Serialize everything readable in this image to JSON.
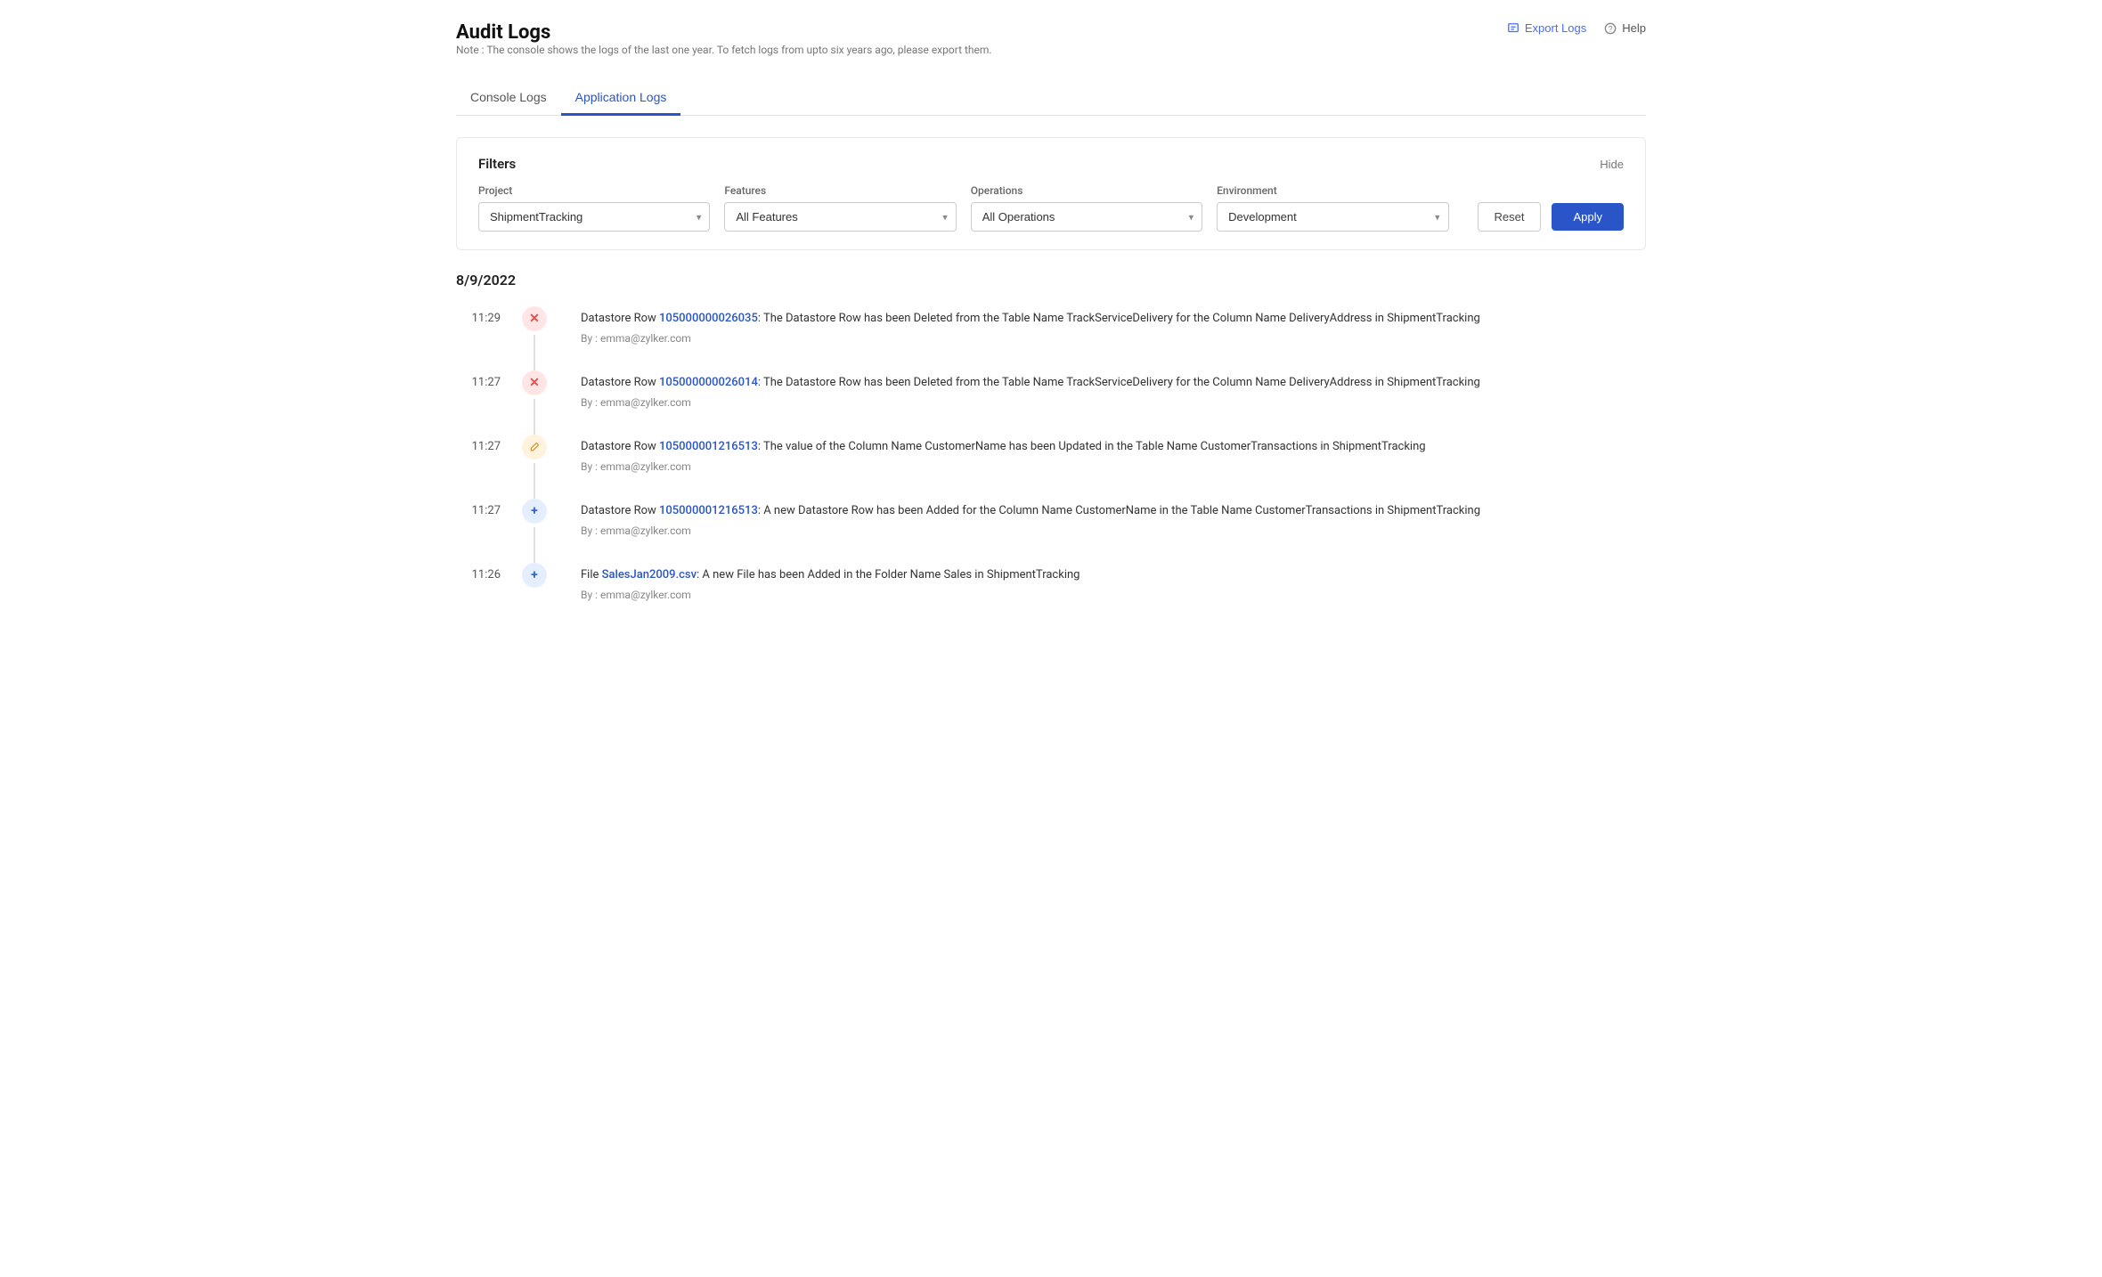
{
  "page": {
    "title": "Audit Logs",
    "note": "Note : The console shows the logs of the last one year. To fetch logs from upto six years ago, please export them."
  },
  "header": {
    "export_label": "Export Logs",
    "help_label": "Help"
  },
  "tabs": [
    {
      "id": "console",
      "label": "Console Logs",
      "active": false
    },
    {
      "id": "application",
      "label": "Application Logs",
      "active": true
    }
  ],
  "filters": {
    "title": "Filters",
    "hide_label": "Hide",
    "reset_label": "Reset",
    "apply_label": "Apply",
    "project": {
      "label": "Project",
      "value": "ShipmentTracking"
    },
    "features": {
      "label": "Features",
      "value": "All Features"
    },
    "operations": {
      "label": "Operations",
      "value": "All Operations"
    },
    "environment": {
      "label": "Environment",
      "value": "Development"
    }
  },
  "date_group": {
    "date": "8/9/2022"
  },
  "logs": [
    {
      "time": "11:29",
      "icon_type": "delete",
      "icon_symbol": "✕",
      "message_prefix": "Datastore Row",
      "link_text": "105000000026035",
      "message_suffix": ": The Datastore Row has been Deleted from the Table Name TrackServiceDelivery for the Column Name DeliveryAddress in ShipmentTracking",
      "by": "By : emma@zylker.com"
    },
    {
      "time": "11:27",
      "icon_type": "delete",
      "icon_symbol": "✕",
      "message_prefix": "Datastore Row",
      "link_text": "105000000026014",
      "message_suffix": ": The Datastore Row has been Deleted from the Table Name TrackServiceDelivery for the Column Name DeliveryAddress in ShipmentTracking",
      "by": "By : emma@zylker.com"
    },
    {
      "time": "11:27",
      "icon_type": "edit",
      "icon_symbol": "✎",
      "message_prefix": "Datastore Row",
      "link_text": "105000001216513",
      "message_suffix": ": The value of the Column Name CustomerName has been Updated in the Table Name CustomerTransactions in ShipmentTracking",
      "by": "By : emma@zylker.com"
    },
    {
      "time": "11:27",
      "icon_type": "add",
      "icon_symbol": "+",
      "message_prefix": "Datastore Row",
      "link_text": "105000001216513",
      "message_suffix": ": A new Datastore Row has been Added for the Column Name CustomerName in the Table Name CustomerTransactions in ShipmentTracking",
      "by": "By : emma@zylker.com"
    },
    {
      "time": "11:26",
      "icon_type": "add",
      "icon_symbol": "+",
      "message_prefix": "File",
      "link_text": "SalesJan2009.csv",
      "message_suffix": ": A new File has been Added in the Folder Name Sales in ShipmentTracking",
      "by": "By : emma@zylker.com"
    }
  ]
}
